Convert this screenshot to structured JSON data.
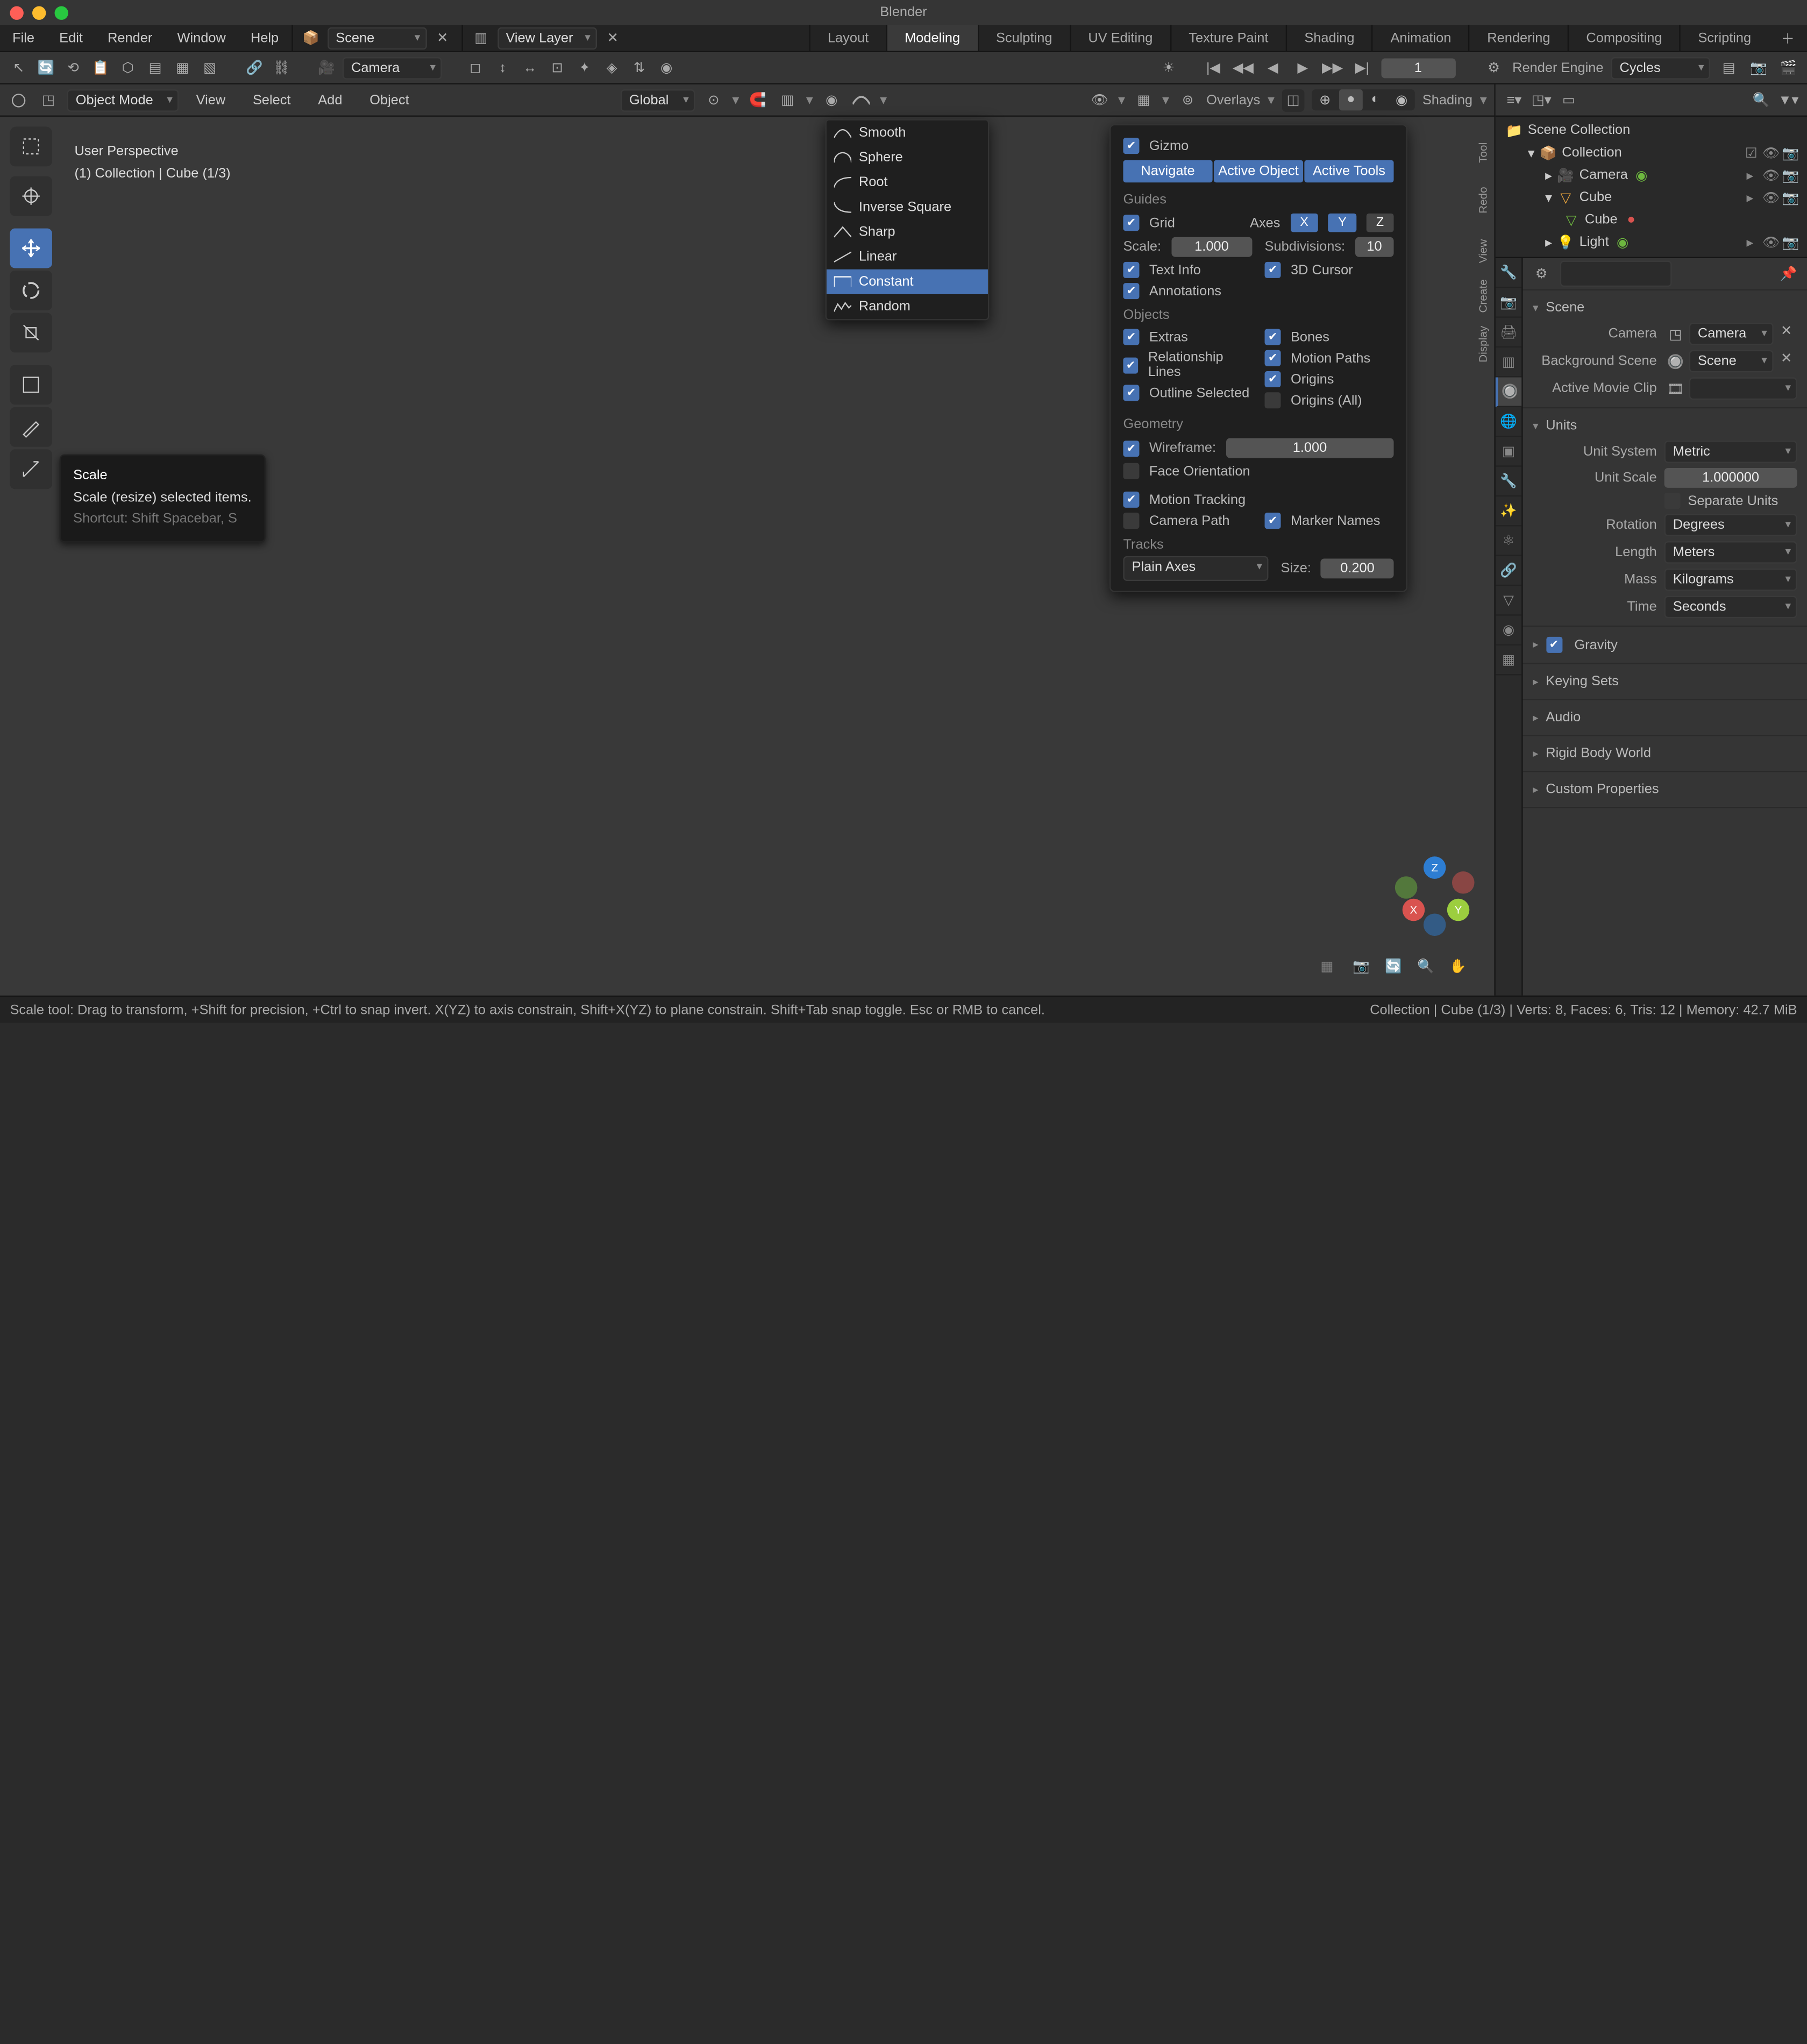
{
  "app": {
    "title": "Blender"
  },
  "menu": [
    "File",
    "Edit",
    "Render",
    "Window",
    "Help"
  ],
  "scene_dropdown": "Scene",
  "viewlayer_dropdown": "View Layer",
  "workspaces": [
    "Layout",
    "Modeling",
    "Sculpting",
    "UV Editing",
    "Texture Paint",
    "Shading",
    "Animation",
    "Rendering",
    "Compositing",
    "Scripting"
  ],
  "workspace_active": "Modeling",
  "tool_header": {
    "pivot_dropdown": "Camera",
    "frame": "1",
    "render_engine_label": "Render Engine",
    "render_engine": "Cycles"
  },
  "view_header": {
    "mode": "Object Mode",
    "menus": [
      "View",
      "Select",
      "Add",
      "Object"
    ],
    "orientation": "Global",
    "overlays_label": "Overlays",
    "shading_label": "Shading"
  },
  "viewport_overlay": {
    "line1": "User Perspective",
    "line2": "(1) Collection | Cube (1/3)"
  },
  "tooltip": {
    "title": "Scale",
    "desc": "Scale (resize) selected items.",
    "shortcut": "Shortcut: Shift Spacebar, S"
  },
  "prop_falloff": {
    "items": [
      "Smooth",
      "Sphere",
      "Root",
      "Inverse Square",
      "Sharp",
      "Linear",
      "Constant",
      "Random"
    ],
    "highlight": "Constant"
  },
  "gizmo_panel": {
    "gizmo_label": "Gizmo",
    "nav_label": "Navigate",
    "active_obj_label": "Active Object",
    "active_tools_label": "Active Tools",
    "guides_label": "Guides",
    "grid_label": "Grid",
    "axes_label": "Axes",
    "scale_label": "Scale:",
    "scale_value": "1.000",
    "subdiv_label": "Subdivisions:",
    "subdiv_value": "10",
    "text_info": "Text Info",
    "cursor_3d": "3D Cursor",
    "annotations": "Annotations",
    "objects_label": "Objects",
    "extras": "Extras",
    "bones": "Bones",
    "rel_lines": "Relationship Lines",
    "motion_paths": "Motion Paths",
    "outline_sel": "Outline Selected",
    "origins": "Origins",
    "origins_all": "Origins (All)",
    "geometry_label": "Geometry",
    "wireframe": "Wireframe:",
    "wireframe_value": "1.000",
    "face_orient": "Face Orientation",
    "motion_tracking": "Motion Tracking",
    "camera_path": "Camera Path",
    "marker_names": "Marker Names",
    "tracks_label": "Tracks",
    "tracks_type": "Plain Axes",
    "size_label": "Size:",
    "size_value": "0.200"
  },
  "vtabs": [
    "Tool",
    "Redo",
    "View",
    "Create",
    "Display"
  ],
  "outliner": {
    "root": "Scene Collection",
    "rows": [
      {
        "name": "Collection",
        "indent": 1,
        "icon": "collection",
        "children": true
      },
      {
        "name": "Camera",
        "indent": 2,
        "icon": "camera"
      },
      {
        "name": "Cube",
        "indent": 2,
        "icon": "mesh",
        "children": true
      },
      {
        "name": "Cube",
        "indent": 3,
        "icon": "data"
      },
      {
        "name": "Light",
        "indent": 2,
        "icon": "light"
      }
    ]
  },
  "properties": {
    "breadcrumb": "Scene",
    "camera_label": "Camera",
    "camera_value": "Camera",
    "bg_scene_label": "Background Scene",
    "bg_scene_value": "Scene",
    "active_clip_label": "Active Movie Clip",
    "units_panel": "Units",
    "unit_system_label": "Unit System",
    "unit_system_value": "Metric",
    "unit_scale_label": "Unit Scale",
    "unit_scale_value": "1.000000",
    "separate_units": "Separate Units",
    "rotation_label": "Rotation",
    "rotation_value": "Degrees",
    "length_label": "Length",
    "length_value": "Meters",
    "mass_label": "Mass",
    "mass_value": "Kilograms",
    "time_label": "Time",
    "time_value": "Seconds",
    "gravity_panel": "Gravity",
    "keying_panel": "Keying Sets",
    "audio_panel": "Audio",
    "rigid_panel": "Rigid Body World",
    "custom_panel": "Custom Properties"
  },
  "status_bar": {
    "left_full": "Scale tool: Drag to transform, +Shift for precision, +Ctrl to snap invert. X(YZ) to axis constrain, Shift+X(YZ) to plane constrain. Shift+Tab snap toggle. Esc or RMB to cancel.",
    "right": "Collection | Cube (1/3) | Verts: 8, Faces: 6, Tris: 12 | Memory: 42.7 MiB"
  },
  "chart_data": null
}
